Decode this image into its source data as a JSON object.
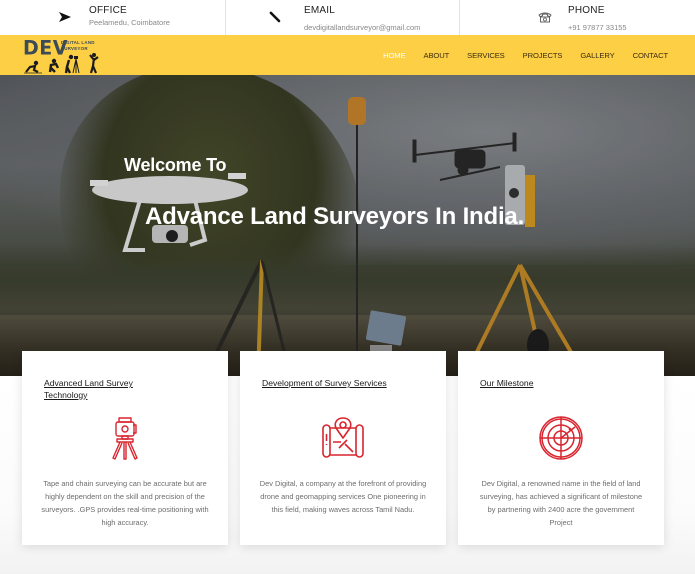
{
  "topbar": {
    "office": {
      "icon": "send-arrow-icon",
      "label": "OFFICE",
      "value": "Peelamedu, Coimbatore"
    },
    "email": {
      "icon": "pencil-icon",
      "label": "EMAIL",
      "value": "devdigitallandsurveyor@gmail.com"
    },
    "phone": {
      "icon": "telephone-icon",
      "label": "PHONE",
      "value": "+91 97877 33155"
    }
  },
  "logo": {
    "main": "DEV",
    "sub_line1": "DIGITAL LAND",
    "sub_line2": "SURVEYOR"
  },
  "nav": {
    "items": [
      {
        "label": "HOME",
        "active": true
      },
      {
        "label": "ABOUT",
        "active": false
      },
      {
        "label": "SERVICES",
        "active": false
      },
      {
        "label": "PROJECTS",
        "active": false
      },
      {
        "label": "GALLERY",
        "active": false
      },
      {
        "label": "CONTACT",
        "active": false
      }
    ]
  },
  "hero": {
    "kicker": "Welcome To",
    "headline": "Advance Land Surveyors In India."
  },
  "cards": [
    {
      "title": "Advanced Land Survey Technology",
      "icon": "total-station-tripod-icon",
      "description": "Tape and chain surveying can be accurate but are highly dependent on the skill and precision of the surveyors. .GPS provides real-time positioning with high accuracy."
    },
    {
      "title": "Development of Survey Services",
      "icon": "map-location-pin-icon",
      "description": "Dev Digital, a company at the forefront of providing drone and geomapping services One pioneering in this field, making waves across Tamil Nadu."
    },
    {
      "title": "Our Milestone",
      "icon": "radar-target-icon",
      "description": "Dev Digital, a renowned name in the field of land surveying, has achieved a significant of milestone by partnering with 2400 acre the government Project"
    }
  ],
  "colors": {
    "brand_yellow": "#fdcf45",
    "logo_slate": "#3d4a57",
    "icon_red": "#d9252f",
    "active_nav": "#ffffff"
  }
}
